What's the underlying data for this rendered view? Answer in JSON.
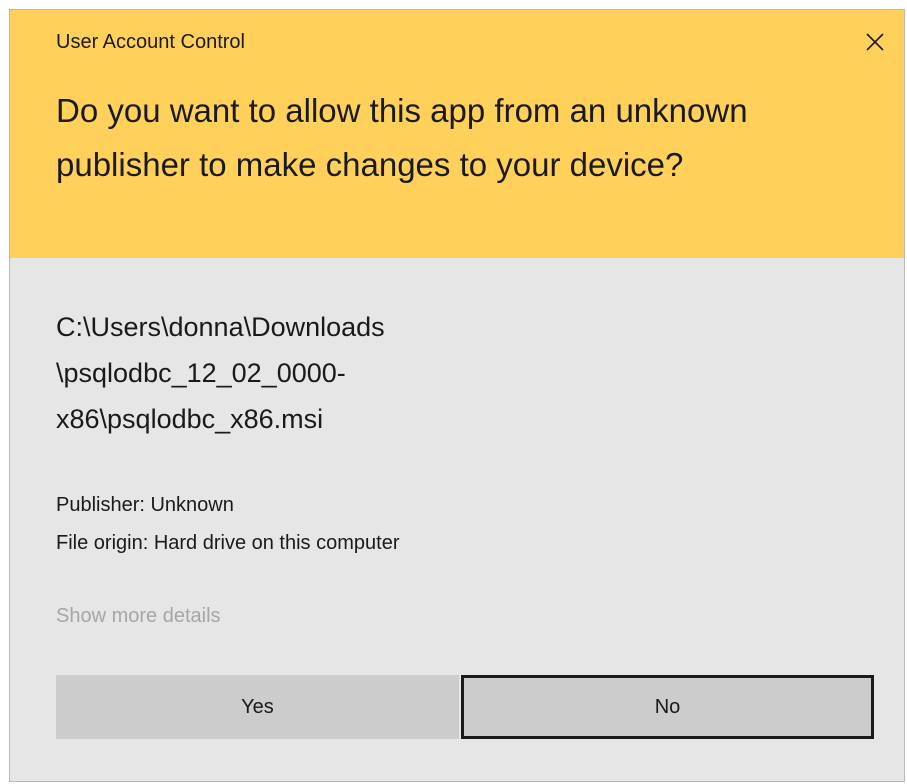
{
  "window": {
    "title": "User Account Control",
    "close_icon": "close-icon",
    "header_color": "#ffd05a",
    "body_color": "#e6e6e6"
  },
  "prompt": {
    "question": "Do you want to allow this app from an unknown publisher to make changes to your device?"
  },
  "program": {
    "path_lines": [
      "C:\\Users\\donna\\Downloads",
      "\\psqlodbc_12_02_0000-",
      "x86\\psqlodbc_x86.msi"
    ],
    "publisher": "Publisher: Unknown",
    "file_origin": "File origin: Hard drive on this computer"
  },
  "details_link": "Show more details",
  "buttons": {
    "yes": "Yes",
    "no": "No"
  }
}
